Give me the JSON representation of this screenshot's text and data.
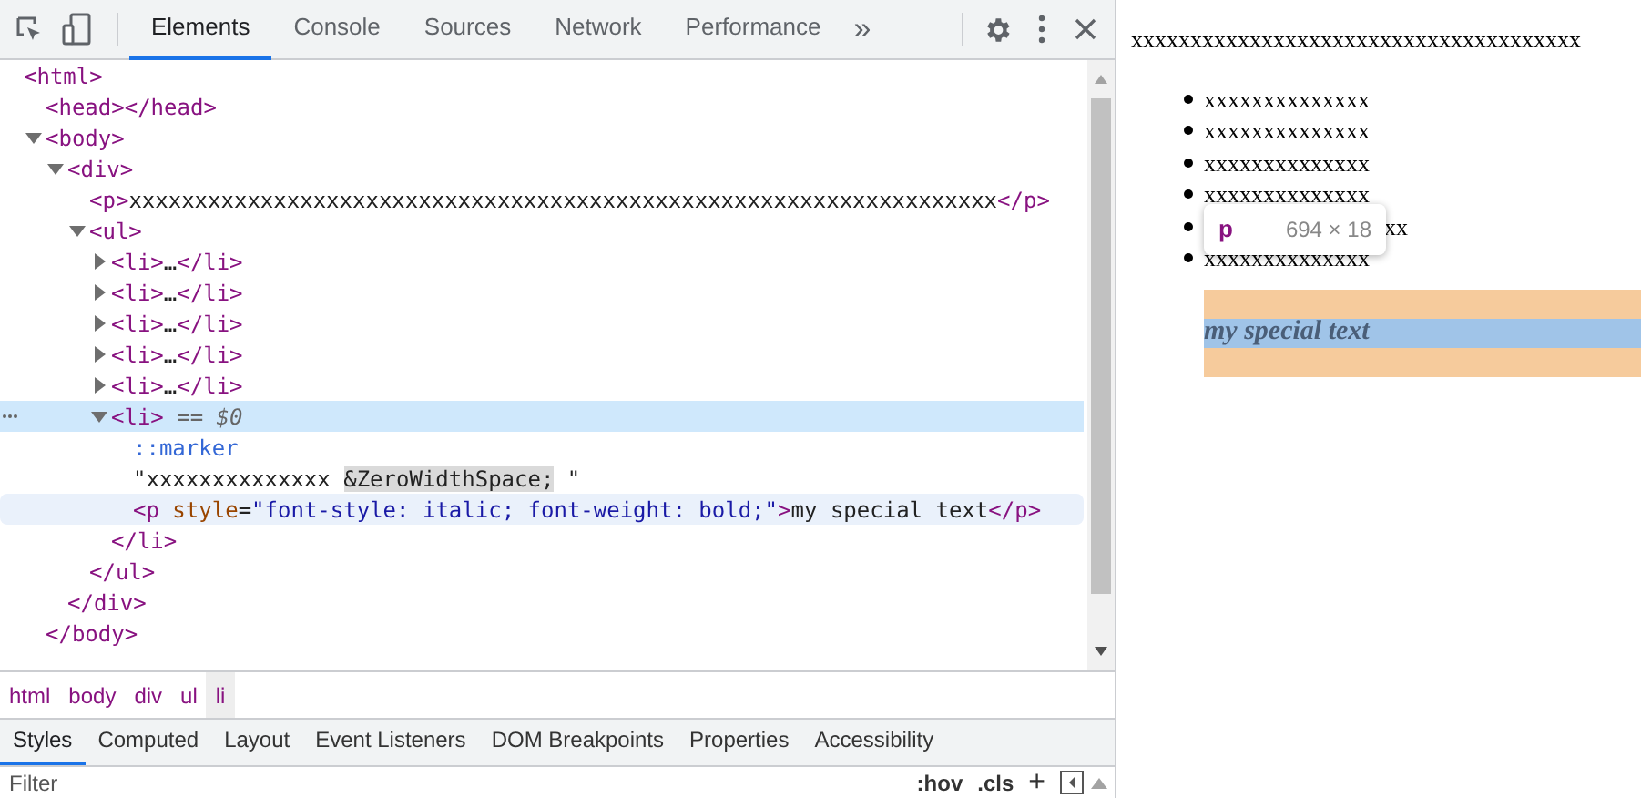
{
  "toolbar": {
    "tabs": [
      {
        "label": "Elements",
        "selected": true
      },
      {
        "label": "Console",
        "selected": false
      },
      {
        "label": "Sources",
        "selected": false
      },
      {
        "label": "Network",
        "selected": false
      },
      {
        "label": "Performance",
        "selected": false
      }
    ],
    "more": "»"
  },
  "dom_tree": [
    {
      "parts": [
        {
          "kind": "tag",
          "text": "<html>"
        }
      ],
      "selected": false,
      "hovered": false,
      "children": [
        {
          "parts": [
            {
              "kind": "tag",
              "text": "<head></head>"
            }
          ],
          "selected": false,
          "hovered": false
        },
        {
          "parts": [
            {
              "kind": "tag",
              "text": "<body>"
            }
          ],
          "expanded": true,
          "selected": false,
          "hovered": false,
          "close": [
            {
              "kind": "tag",
              "text": "</body>"
            }
          ],
          "children": [
            {
              "parts": [
                {
                  "kind": "tag",
                  "text": "<div>"
                }
              ],
              "expanded": true,
              "selected": false,
              "hovered": false,
              "close": [
                {
                  "kind": "tag",
                  "text": "</div>"
                }
              ],
              "children": [
                {
                  "parts": [
                    {
                      "kind": "tag",
                      "text": "<p>"
                    },
                    {
                      "kind": "text",
                      "text": "xxxxxxxxxxxxxxxxxxxxxxxxxxxxxxxxxxxxxxxxxxxxxxxxxxxxxxxxxxxxxxxxxx"
                    },
                    {
                      "kind": "tag",
                      "text": "</p>"
                    }
                  ],
                  "selected": false,
                  "hovered": false
                },
                {
                  "parts": [
                    {
                      "kind": "tag",
                      "text": "<ul>"
                    }
                  ],
                  "expanded": true,
                  "selected": false,
                  "hovered": false,
                  "close": [
                    {
                      "kind": "tag",
                      "text": "</ul>"
                    }
                  ],
                  "children": [
                    {
                      "parts": [
                        {
                          "kind": "tag",
                          "text": "<li>"
                        },
                        {
                          "kind": "text",
                          "text": "…"
                        },
                        {
                          "kind": "tag",
                          "text": "</li>"
                        }
                      ],
                      "expanded": false,
                      "selected": false,
                      "hovered": false
                    },
                    {
                      "parts": [
                        {
                          "kind": "tag",
                          "text": "<li>"
                        },
                        {
                          "kind": "text",
                          "text": "…"
                        },
                        {
                          "kind": "tag",
                          "text": "</li>"
                        }
                      ],
                      "expanded": false,
                      "selected": false,
                      "hovered": false
                    },
                    {
                      "parts": [
                        {
                          "kind": "tag",
                          "text": "<li>"
                        },
                        {
                          "kind": "text",
                          "text": "…"
                        },
                        {
                          "kind": "tag",
                          "text": "</li>"
                        }
                      ],
                      "expanded": false,
                      "selected": false,
                      "hovered": false
                    },
                    {
                      "parts": [
                        {
                          "kind": "tag",
                          "text": "<li>"
                        },
                        {
                          "kind": "text",
                          "text": "…"
                        },
                        {
                          "kind": "tag",
                          "text": "</li>"
                        }
                      ],
                      "expanded": false,
                      "selected": false,
                      "hovered": false
                    },
                    {
                      "parts": [
                        {
                          "kind": "tag",
                          "text": "<li>"
                        },
                        {
                          "kind": "text",
                          "text": "…"
                        },
                        {
                          "kind": "tag",
                          "text": "</li>"
                        }
                      ],
                      "expanded": false,
                      "selected": false,
                      "hovered": false
                    },
                    {
                      "parts": [
                        {
                          "kind": "tag",
                          "text": "<li>"
                        },
                        {
                          "kind": "note",
                          "text": " == $0"
                        }
                      ],
                      "expanded": true,
                      "selected": true,
                      "hovered": false,
                      "close": [
                        {
                          "kind": "tag",
                          "text": "</li>"
                        }
                      ],
                      "children": [
                        {
                          "parts": [
                            {
                              "kind": "pseudo",
                              "text": "::marker"
                            }
                          ],
                          "selected": false,
                          "hovered": false
                        },
                        {
                          "parts": [
                            {
                              "kind": "text",
                              "text": "\"xxxxxxxxxxxxxx "
                            },
                            {
                              "kind": "entity",
                              "text": "&ZeroWidthSpace;"
                            },
                            {
                              "kind": "text",
                              "text": " \""
                            }
                          ],
                          "selected": false,
                          "hovered": false
                        },
                        {
                          "parts": [
                            {
                              "kind": "tag",
                              "text": "<p"
                            },
                            {
                              "kind": "attr",
                              "text": " style"
                            },
                            {
                              "kind": "text",
                              "text": "="
                            },
                            {
                              "kind": "value",
                              "text": "\"font-style: italic; font-weight: bold;\""
                            },
                            {
                              "kind": "tag",
                              "text": ">"
                            },
                            {
                              "kind": "text",
                              "text": "my special text"
                            },
                            {
                              "kind": "tag",
                              "text": "</p>"
                            }
                          ],
                          "selected": false,
                          "hovered": true
                        }
                      ]
                    }
                  ]
                }
              ]
            }
          ]
        }
      ]
    }
  ],
  "breadcrumbs": [
    {
      "label": "html",
      "selected": false
    },
    {
      "label": "body",
      "selected": false
    },
    {
      "label": "div",
      "selected": false
    },
    {
      "label": "ul",
      "selected": false
    },
    {
      "label": "li",
      "selected": true
    }
  ],
  "panel_tabs": [
    {
      "label": "Styles",
      "selected": true
    },
    {
      "label": "Computed",
      "selected": false
    },
    {
      "label": "Layout",
      "selected": false
    },
    {
      "label": "Event Listeners",
      "selected": false
    },
    {
      "label": "DOM Breakpoints",
      "selected": false
    },
    {
      "label": "Properties",
      "selected": false
    },
    {
      "label": "Accessibility",
      "selected": false
    }
  ],
  "filter": {
    "placeholder": "Filter",
    "hov": ":hov",
    "cls": ".cls",
    "add": "+"
  },
  "page": {
    "paragraph": "xxxxxxxxxxxxxxxxxxxxxxxxxxxxxxxxxxxxxx",
    "list": [
      {
        "text": "xxxxxxxxxxxxxx",
        "kind": "full"
      },
      {
        "text": "xxxxxxxxxxxxxx",
        "kind": "full"
      },
      {
        "text": "xxxxxxxxxxxxxx",
        "kind": "full"
      },
      {
        "text": "xxxxxxxxxxxxxx",
        "kind": "full"
      },
      {
        "text": "xx",
        "kind": "covered"
      },
      {
        "text": "xxxxxxxxxxxxxx",
        "kind": "full"
      }
    ],
    "special": "my special text",
    "tooltip": {
      "tag": "p",
      "size": "694 × 18"
    }
  }
}
